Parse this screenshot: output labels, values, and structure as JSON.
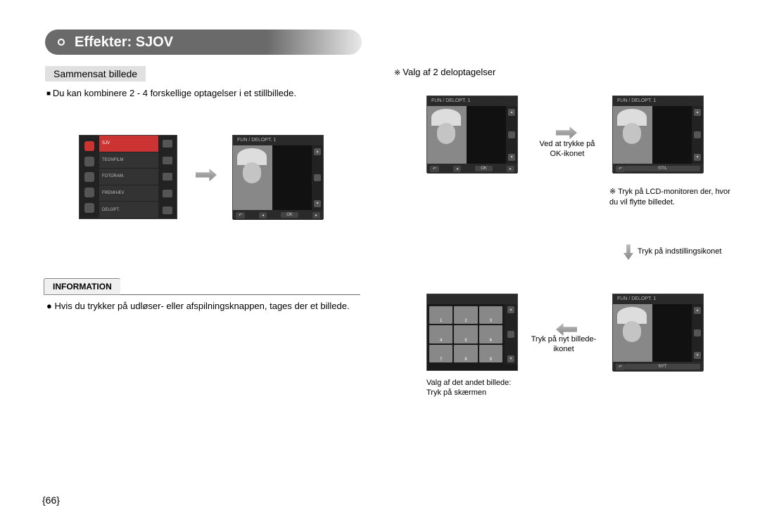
{
  "page_title": "Effekter: SJOV",
  "section_left": {
    "heading": "Sammensat billede",
    "desc": "Du kan kombinere 2 - 4 forskellige optagelser i et stillbillede."
  },
  "info_box": {
    "label": "INFORMATION",
    "text": "Hvis du trykker på udløser- eller afspilningsknappen, tages der et billede."
  },
  "section_right": {
    "heading": "Valg af 2 deloptagelser",
    "arrow1_caption": "Ved at trykke på OK-ikonet",
    "hint1": "Tryk på LCD-monitoren der, hvor du vil flytte billedet.",
    "down_caption": "Tryk på indstillingsikonet",
    "arrow_left_caption": "Tryk på nyt billede-ikonet",
    "grid_caption_line1": "Valg af det andet billede:",
    "grid_caption_line2": "Tryk på skærmen"
  },
  "lcd_menu": {
    "items": [
      "SJV",
      "TEGNFILM",
      "FOTORAM.",
      "FREMHÆV",
      "DELOPT."
    ],
    "active_index": 0
  },
  "lcd_preview_title": "FUN  / DELOPT. 1",
  "lcd_bottom_ok": "OK",
  "lcd_bottom_stil": "STIL",
  "lcd_bottom_nyt": "NYT",
  "page_number": "{66}"
}
